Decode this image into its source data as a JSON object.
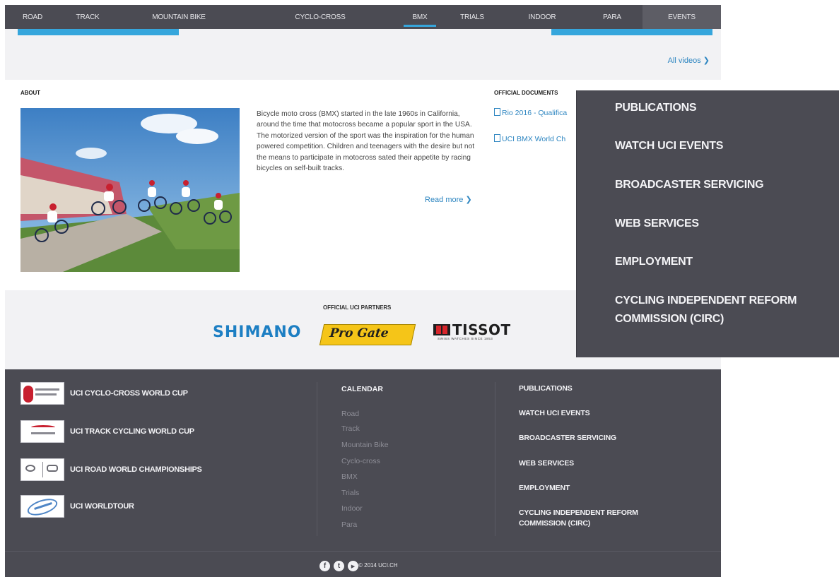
{
  "topnav": {
    "items": [
      {
        "label": "ROAD"
      },
      {
        "label": "TRACK"
      },
      {
        "label": "MOUNTAIN BIKE"
      },
      {
        "label": "CYCLO-CROSS"
      },
      {
        "label": "BMX"
      },
      {
        "label": "TRIALS"
      },
      {
        "label": "INDOOR"
      },
      {
        "label": "PARA"
      },
      {
        "label": "EVENTS"
      }
    ],
    "active": "BMX"
  },
  "videos": {
    "all_videos_label": "All videos ❯"
  },
  "about": {
    "title": "ABOUT",
    "text": "Bicycle moto cross (BMX) started in the late 1960s in California, around the time that motocross became a popular sport in the USA. The motorized version of the sport was the inspiration for the human powered competition. Children and teenagers with the desire but not the means to participate in motocross sated their appetite by racing bicycles on self-built tracks.",
    "read_more": "Read more ❯"
  },
  "official_documents": {
    "title": "OFFICIAL DOCUMENTS",
    "links": [
      {
        "label": "Rio 2016 - Qualifica"
      },
      {
        "label": "UCI BMX World Ch"
      }
    ]
  },
  "partners": {
    "title": "OFFICIAL UCI PARTNERS",
    "logos": [
      {
        "name": "SHIMANO",
        "color": "#1d7fc3"
      },
      {
        "name": "Pro Gate",
        "color": "#f5c518"
      },
      {
        "name": "TISSOT",
        "tagline": "SWISS WATCHES SINCE 1853"
      }
    ]
  },
  "footer": {
    "world_cups": [
      {
        "label": "UCI CYCLO-CROSS WORLD CUP"
      },
      {
        "label": "UCI TRACK CYCLING WORLD CUP"
      },
      {
        "label": "UCI ROAD WORLD CHAMPIONSHIPS"
      },
      {
        "label": "UCI WORLDTOUR"
      }
    ],
    "calendar": {
      "title": "CALENDAR",
      "items": [
        "Road",
        "Track",
        "Mountain Bike",
        "Cyclo-cross",
        "BMX",
        "Trials",
        "Indoor",
        "Para"
      ]
    },
    "links": [
      "PUBLICATIONS",
      "WATCH UCI EVENTS",
      "BROADCASTER SERVICING",
      "WEB SERVICES",
      "EMPLOYMENT",
      "CYCLING INDEPENDENT REFORM COMMISSION (CIRC)"
    ],
    "social": [
      {
        "icon": "facebook-icon",
        "glyph": "f"
      },
      {
        "icon": "twitter-icon",
        "glyph": "t"
      },
      {
        "icon": "youtube-icon",
        "glyph": "▶"
      }
    ],
    "copyright": "© 2014 UCI.CH"
  },
  "zoom_panel": {
    "items": [
      "PUBLICATIONS",
      "WATCH UCI EVENTS",
      "BROADCASTER SERVICING",
      "WEB SERVICES",
      "EMPLOYMENT",
      "CYCLING INDEPENDENT REFORM",
      "COMMISSION (CIRC)"
    ]
  },
  "colors": {
    "nav_bg": "#4b4b53",
    "accent": "#36a6dc",
    "link": "#2e86c1",
    "footer_bg": "#4b4b53",
    "band_bg": "#f2f2f4"
  }
}
